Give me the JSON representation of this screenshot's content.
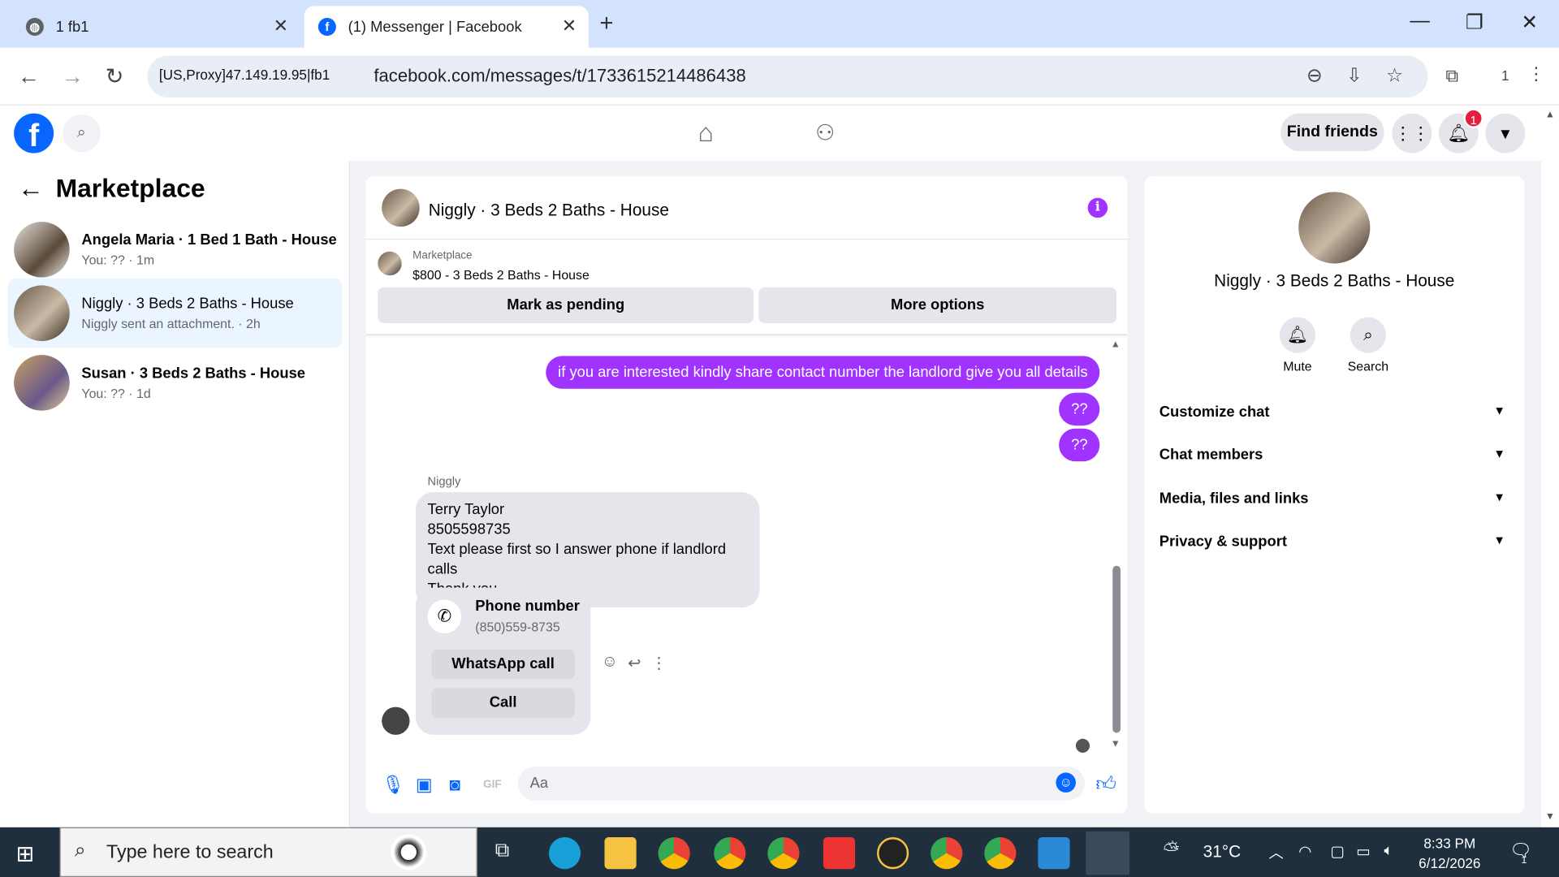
{
  "browser": {
    "tabs": [
      {
        "title": "1 fb1"
      },
      {
        "title": "(1) Messenger | Facebook"
      }
    ],
    "proxy_chip": "[US,Proxy]47.149.19.95|fb1",
    "url": "facebook.com/messages/t/1733615214486438",
    "profile_count": "1"
  },
  "fb_header": {
    "find_friends": "Find friends",
    "notifications_count": "1"
  },
  "sidebar": {
    "title": "Marketplace",
    "conversations": [
      {
        "name": "Angela Maria · 1 Bed 1 Bath - House",
        "sub": "You: ?? · 1m",
        "active": false
      },
      {
        "name": "Niggly · 3 Beds 2 Baths - House",
        "sub": "Niggly sent an attachment. · 2h",
        "active": true
      },
      {
        "name": "Susan · 3 Beds 2 Baths - House",
        "sub": "You: ?? · 1d",
        "active": false
      }
    ]
  },
  "chat": {
    "title": "Niggly · 3 Beds 2 Baths - House",
    "marketplace_label": "Marketplace",
    "listing": "$800 - 3 Beds 2 Baths - House",
    "mark_pending": "Mark as pending",
    "more_options": "More options",
    "outgoing": [
      "if you are interested kindly share contact number the landlord give you all details",
      "??",
      "??"
    ],
    "sender_name": "Niggly",
    "incoming_lines": [
      "Terry Taylor",
      "8505598735",
      "Text please first so I answer phone if landlord calls",
      "Thank you"
    ],
    "phone_card": {
      "title": "Phone number",
      "number": "(850)559-8735",
      "whatsapp": "WhatsApp call",
      "call": "Call"
    },
    "composer_placeholder": "Aa"
  },
  "right_panel": {
    "name": "Niggly · 3 Beds 2 Baths - House",
    "actions": [
      {
        "label": "Mute",
        "icon": "bell-icon"
      },
      {
        "label": "Search",
        "icon": "search-icon"
      }
    ],
    "sections": [
      "Customize chat",
      "Chat members",
      "Media, files and links",
      "Privacy & support"
    ]
  },
  "taskbar": {
    "search_placeholder": "Type here to search",
    "weather": "31°C",
    "time": "8:33 PM",
    "date": "6/12/2026",
    "notif_count": "1"
  }
}
